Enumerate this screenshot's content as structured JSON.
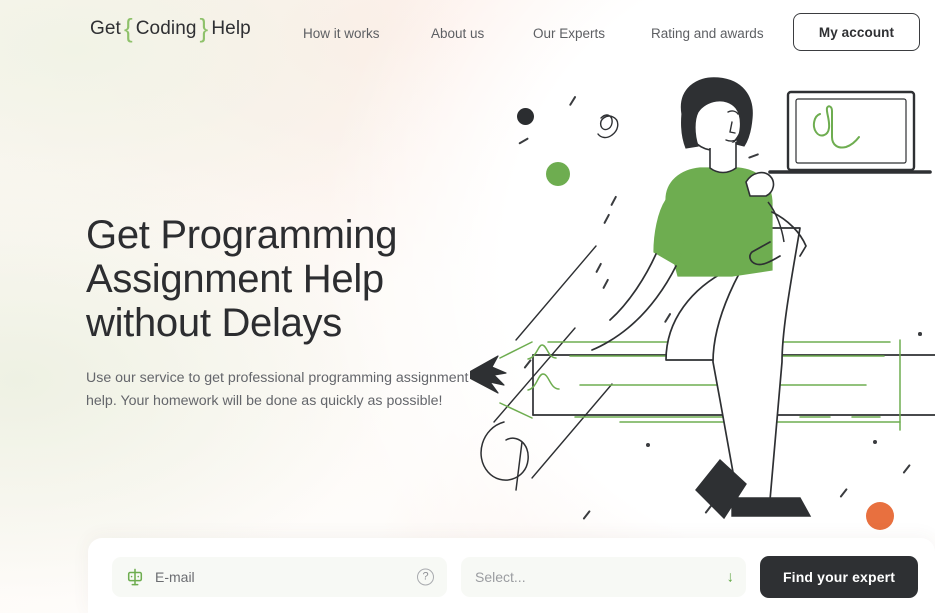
{
  "header": {
    "logo": {
      "prefix": "Get",
      "brace_open": "{",
      "word": "Coding",
      "brace_close": "}",
      "suffix": "Help"
    },
    "nav": [
      {
        "label": "How it works"
      },
      {
        "label": "About us"
      },
      {
        "label": "Our Experts"
      },
      {
        "label": "Rating and awards"
      }
    ],
    "account_button": "My account"
  },
  "hero": {
    "title": "Get Programming\nAssignment Help\nwithout Delays",
    "subtitle": "Use our service to get professional programming assignment\nhelp. Your homework will be done as quickly as possible!"
  },
  "form": {
    "email_label": "E-mail",
    "email_icon": "mailbox-icon",
    "help_icon": "?",
    "select_placeholder": "Select...",
    "select_caret": "↓",
    "submit_label": "Find your expert"
  },
  "illustration": {
    "description": "woman-with-laptop-sitting-on-pencil",
    "laptop_screen_glyph": "green-squiggle"
  },
  "colors": {
    "accent_green": "#6ead50",
    "logo_green": "#8ec16a",
    "accent_orange": "#e8703f",
    "dark": "#2e3033",
    "text_body": "#64666b"
  }
}
